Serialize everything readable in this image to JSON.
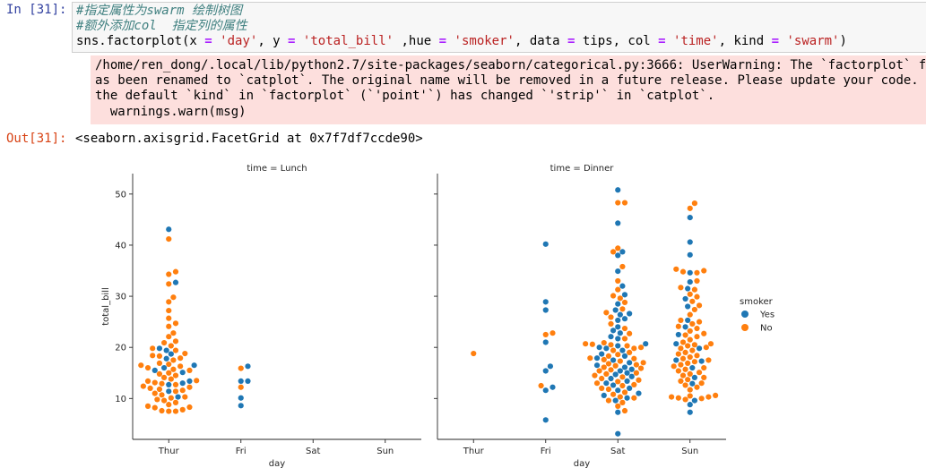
{
  "cell": {
    "in_prompt": "In [31]:",
    "out_prompt": "Out[31]:",
    "code": {
      "comment1": "#指定属性为swarm 绘制树图",
      "comment2": "#额外添加col  指定列的属性",
      "line3": [
        {
          "t": "sns.factorplot(x ",
          "c": "kw-name"
        },
        {
          "t": "=",
          "c": "op"
        },
        {
          "t": " ",
          "c": "kw-name"
        },
        {
          "t": "'day'",
          "c": "str"
        },
        {
          "t": ", y ",
          "c": "kw-name"
        },
        {
          "t": "=",
          "c": "op"
        },
        {
          "t": " ",
          "c": "kw-name"
        },
        {
          "t": "'total_bill'",
          "c": "str"
        },
        {
          "t": " ,hue ",
          "c": "kw-name"
        },
        {
          "t": "=",
          "c": "op"
        },
        {
          "t": " ",
          "c": "kw-name"
        },
        {
          "t": "'smoker'",
          "c": "str"
        },
        {
          "t": ", data ",
          "c": "kw-name"
        },
        {
          "t": "=",
          "c": "op"
        },
        {
          "t": " tips, col ",
          "c": "kw-name"
        },
        {
          "t": "=",
          "c": "op"
        },
        {
          "t": " ",
          "c": "kw-name"
        },
        {
          "t": "'time'",
          "c": "str"
        },
        {
          "t": ", kind ",
          "c": "kw-name"
        },
        {
          "t": "=",
          "c": "op"
        },
        {
          "t": " ",
          "c": "kw-name"
        },
        {
          "t": "'swarm'",
          "c": "str"
        },
        {
          "t": ")",
          "c": "kw-name"
        }
      ]
    },
    "stderr_lines": [
      "/home/ren_dong/.local/lib/python2.7/site-packages/seaborn/categorical.py:3666: UserWarning: The `factorplot` functio",
      "as been renamed to `catplot`. The original name will be removed in a future release. Please update your code. Note t",
      "the default `kind` in `factorplot` (`'point'`) has changed `'strip'` in `catplot`.",
      "  warnings.warn(msg)"
    ],
    "output_repr": "<seaborn.axisgrid.FacetGrid at 0x7f7df7ccde90>"
  },
  "chart_data": {
    "type": "scatter",
    "kind": "swarm",
    "ylabel": "total_bill",
    "xlabel": "day",
    "categories": [
      "Thur",
      "Fri",
      "Sat",
      "Sun"
    ],
    "ylim": [
      2,
      54
    ],
    "yticks": [
      10,
      20,
      30,
      40,
      50
    ],
    "grid": false,
    "legend": {
      "title": "smoker",
      "placement": "right",
      "entries": [
        {
          "name": "Yes",
          "color": "#1f77b4"
        },
        {
          "name": "No",
          "color": "#ff7f0e"
        }
      ]
    },
    "panels": [
      {
        "title": "time = Lunch",
        "series": [
          {
            "name": "Yes",
            "color": "#1f77b4",
            "points": {
              "Thur": [
                43.1,
                32.7,
                19.8,
                19.4,
                18.7,
                17.8,
                16.5,
                16.0,
                15.5,
                15.1,
                13.4,
                13.0,
                12.7,
                11.4,
                10.3
              ],
              "Fri": [
                16.3,
                13.4,
                13.4,
                10.1,
                8.6
              ]
            }
          },
          {
            "name": "No",
            "color": "#ff7f0e",
            "points": {
              "Thur": [
                41.2,
                34.8,
                34.3,
                32.4,
                29.8,
                28.9,
                27.2,
                25.7,
                24.7,
                24.1,
                22.8,
                22.1,
                21.2,
                20.9,
                20.3,
                19.8,
                19.4,
                18.8,
                18.4,
                18.3,
                17.9,
                17.5,
                16.9,
                16.7,
                16.5,
                16.3,
                16.0,
                15.7,
                15.5,
                15.0,
                14.8,
                14.5,
                14.1,
                13.8,
                13.5,
                13.4,
                13.1,
                12.9,
                12.7,
                12.4,
                12.2,
                12.0,
                11.8,
                11.6,
                11.4,
                11.0,
                10.7,
                10.3,
                10.1,
                9.8,
                9.6,
                9.2,
                8.8,
                8.5,
                8.2,
                7.8,
                7.5,
                7.6,
                7.5,
                8.3
              ],
              "Fri": [
                15.9,
                12.2
              ]
            }
          }
        ]
      },
      {
        "title": "time = Dinner",
        "series": [
          {
            "name": "Yes",
            "color": "#1f77b4",
            "points": {
              "Fri": [
                40.2,
                28.9,
                27.3,
                21.0,
                16.3,
                15.4,
                12.2,
                11.6,
                5.8
              ],
              "Sat": [
                50.8,
                44.3,
                38.7,
                38.0,
                34.9,
                32.0,
                30.3,
                28.5,
                27.3,
                26.6,
                26.4,
                25.6,
                25.3,
                24.0,
                23.3,
                22.8,
                22.1,
                21.7,
                20.7,
                20.3,
                20.0,
                19.8,
                19.4,
                18.7,
                18.3,
                17.9,
                17.5,
                17.0,
                16.5,
                16.1,
                15.7,
                15.4,
                15.0,
                14.7,
                14.3,
                13.9,
                13.4,
                13.0,
                12.6,
                12.0,
                11.6,
                11.0,
                10.6,
                10.1,
                9.6,
                7.3,
                3.1
              ],
              "Sun": [
                45.4,
                40.6,
                38.1,
                34.6,
                32.8,
                31.5,
                29.5,
                28.0,
                25.3,
                24.0,
                22.5,
                20.7,
                19.8,
                17.5,
                17.3,
                16.0,
                14.1,
                12.9,
                9.6,
                8.8,
                7.3
              ]
            }
          },
          {
            "name": "No",
            "color": "#ff7f0e",
            "points": {
              "Thur": [
                18.8
              ],
              "Fri": [
                22.8,
                22.5,
                12.5
              ],
              "Sat": [
                48.3,
                48.3,
                39.4,
                38.7,
                35.8,
                33.0,
                31.3,
                30.1,
                29.6,
                28.8,
                27.5,
                26.8,
                25.9,
                24.6,
                23.7,
                22.7,
                21.7,
                20.9,
                20.7,
                20.6,
                20.5,
                20.3,
                20.0,
                19.8,
                19.4,
                19.0,
                18.6,
                18.3,
                17.9,
                17.8,
                17.6,
                17.3,
                17.0,
                16.8,
                16.6,
                16.4,
                16.1,
                15.9,
                15.6,
                15.4,
                15.0,
                14.8,
                14.5,
                14.2,
                13.9,
                13.6,
                13.3,
                13.0,
                12.7,
                12.5,
                12.0,
                11.8,
                11.2,
                10.8,
                10.3,
                10.1,
                9.6,
                9.2,
                8.5,
                7.6
              ],
              "Sun": [
                48.2,
                47.2,
                35.3,
                35.0,
                34.8,
                34.6,
                33.0,
                31.7,
                31.3,
                30.4,
                29.9,
                29.0,
                28.2,
                27.4,
                26.4,
                25.3,
                25.0,
                24.6,
                24.1,
                23.7,
                23.2,
                22.7,
                22.4,
                22.1,
                21.5,
                21.0,
                20.7,
                20.5,
                20.3,
                20.0,
                19.8,
                19.4,
                19.0,
                18.7,
                18.4,
                18.1,
                17.8,
                17.5,
                17.2,
                16.9,
                16.6,
                16.3,
                16.0,
                15.7,
                15.4,
                15.1,
                14.8,
                14.5,
                14.1,
                13.7,
                13.4,
                13.0,
                12.6,
                12.2,
                11.7,
                10.6,
                10.5,
                10.3,
                10.3,
                10.1,
                10.0,
                9.8
              ]
            }
          }
        ]
      }
    ]
  }
}
